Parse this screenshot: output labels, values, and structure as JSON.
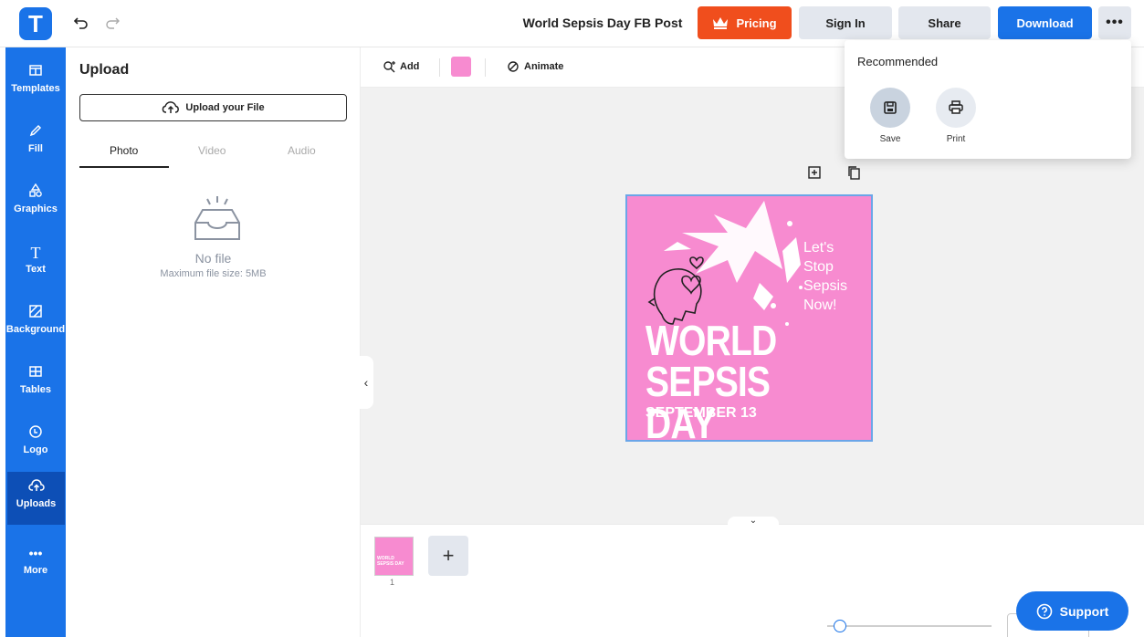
{
  "app": {
    "logo_letter": "T",
    "brand_color": "#1a73e8",
    "accent_color": "#f04e1d"
  },
  "header": {
    "document_title": "World Sepsis Day FB Post",
    "pricing_label": "Pricing",
    "signin_label": "Sign In",
    "share_label": "Share",
    "download_label": "Download",
    "more_label": "•••"
  },
  "sidebar": {
    "items": [
      {
        "label": "Templates",
        "icon": "templates-icon"
      },
      {
        "label": "Fill",
        "icon": "pen-icon"
      },
      {
        "label": "Graphics",
        "icon": "shapes-icon"
      },
      {
        "label": "Text",
        "icon": "text-icon"
      },
      {
        "label": "Background",
        "icon": "background-icon"
      },
      {
        "label": "Tables",
        "icon": "table-icon"
      },
      {
        "label": "Logo",
        "icon": "logo-icon"
      },
      {
        "label": "Uploads",
        "icon": "cloud-upload-icon",
        "active": true
      },
      {
        "label": "More",
        "icon": "more-icon"
      }
    ]
  },
  "upload_panel": {
    "title": "Upload",
    "upload_button": "Upload your File",
    "tabs": [
      "Photo",
      "Video",
      "Audio"
    ],
    "active_tab": "Photo",
    "empty_title": "No file",
    "empty_hint": "Maximum file size: 5MB"
  },
  "toolbar": {
    "add_label": "Add",
    "fill_color": "#f78bd0",
    "animate_label": "Animate"
  },
  "design": {
    "tagline": [
      "Let's",
      "Stop",
      "Sepsis",
      "Now!"
    ],
    "headline_line1": "WORLD",
    "headline_line2": "SEPSIS DAY",
    "date": "SEPTEMBER 13",
    "background_color": "#f78bd0"
  },
  "pages": {
    "thumbnails": [
      {
        "number": "1",
        "line1": "WORLD",
        "line2": "SEPSIS DAY"
      }
    ],
    "add_label": "+"
  },
  "menu": {
    "title": "Recommended",
    "items": [
      {
        "label": "Save",
        "icon": "save-icon"
      },
      {
        "label": "Print",
        "icon": "print-icon"
      }
    ]
  },
  "support": {
    "label": "Support"
  }
}
